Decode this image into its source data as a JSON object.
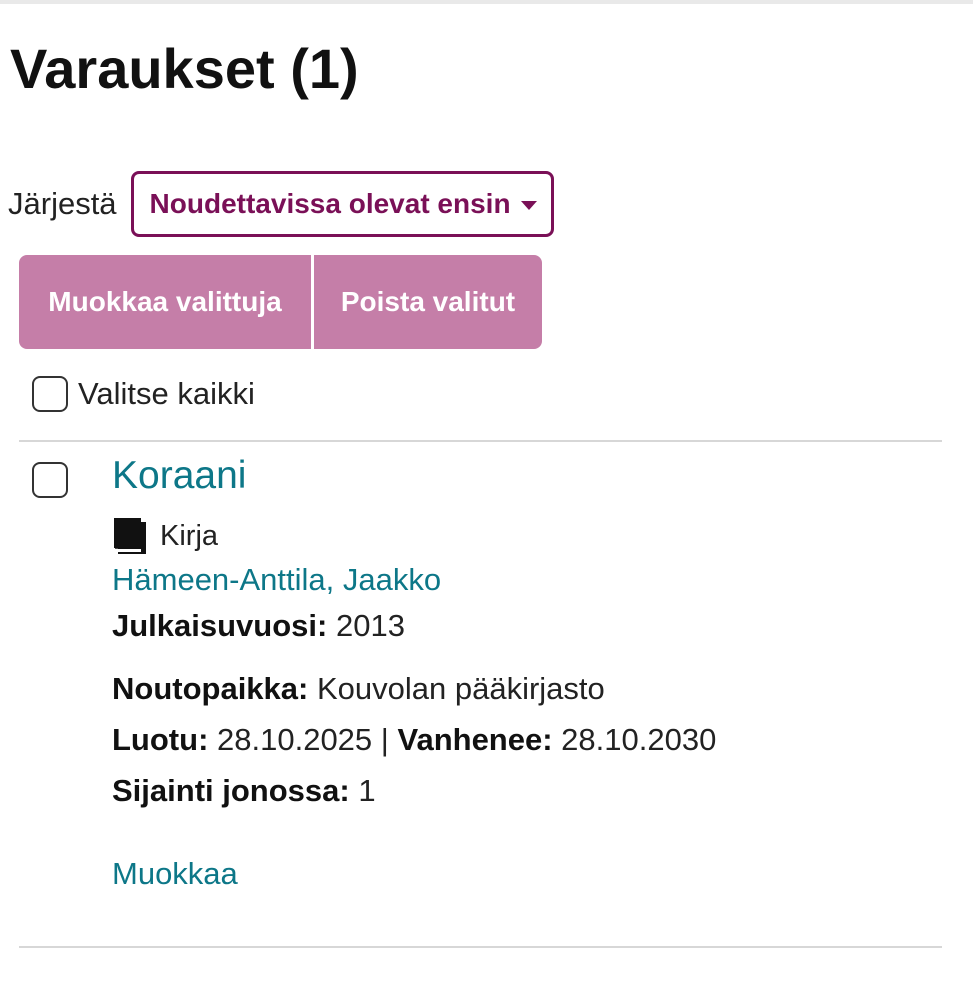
{
  "page": {
    "title": "Varaukset (1)"
  },
  "sort": {
    "label": "Järjestä",
    "selected": "Noudettavissa olevat ensin"
  },
  "actions": {
    "edit_selected": "Muokkaa valittuja",
    "delete_selected": "Poista valitut"
  },
  "select_all": {
    "label": "Valitse kaikki",
    "checked": false
  },
  "holds": [
    {
      "title": "Koraani",
      "format": "Kirja",
      "format_icon": "book-icon",
      "author": "Hämeen-Anttila, Jaakko",
      "year_label": "Julkaisuvuosi:",
      "year": "2013",
      "pickup_label": "Noutopaikka:",
      "pickup": "Kouvolan pääkirjasto",
      "created_label": "Luotu:",
      "created": "28.10.2025",
      "separator": "|",
      "expires_label": "Vanhenee:",
      "expires": "28.10.2030",
      "queue_label": "Sijainti jonossa:",
      "queue": "1",
      "edit_link": "Muokkaa",
      "checked": false
    }
  ],
  "colors": {
    "brand": "#7a1057",
    "button_bg": "#c57ea8",
    "link": "#0d7788"
  }
}
